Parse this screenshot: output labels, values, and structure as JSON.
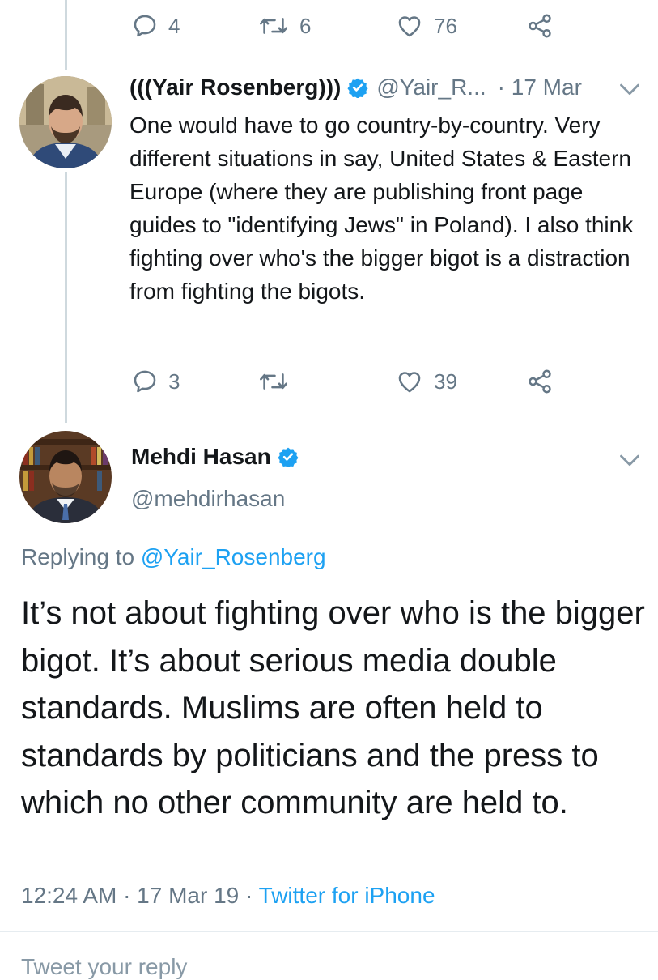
{
  "prev_tweet_actions": {
    "reply_count": "4",
    "retweet_count": "6",
    "like_count": "76"
  },
  "reply_tweet": {
    "display_name": "(((Yair Rosenberg)))",
    "handle": "@Yair_R...",
    "time": "· 17 Mar",
    "text": "One would have to go country-by-country. Very different situations in say, United States & Eastern Europe (where they are publishing front page guides to \"identifying Jews\" in Poland). I also think fighting over who's the bigger bigot is a distraction from fighting the bigots.",
    "reply_count": "3",
    "retweet_count": "",
    "like_count": "39"
  },
  "main_tweet": {
    "display_name": "Mehdi Hasan",
    "handle": "@mehdirhasan",
    "replying_prefix": "Replying to",
    "replying_to": "@Yair_Rosenberg",
    "text": "It’s not about fighting over who is the bigger bigot. It’s about serious media double standards. Muslims are often held to standards by politicians and the press to which no other community are held to.",
    "timestamp": "12:24 AM · 17 Mar 19 ·",
    "source": "Twitter for iPhone"
  },
  "compose": {
    "placeholder": "Tweet your reply"
  },
  "colors": {
    "link": "#1da1f2",
    "muted": "#657786",
    "text": "#14171a",
    "verified": "#1da1f2"
  },
  "icons": [
    "reply-icon",
    "retweet-icon",
    "like-icon",
    "share-icon",
    "verified-badge-icon",
    "chevron-down-icon"
  ]
}
